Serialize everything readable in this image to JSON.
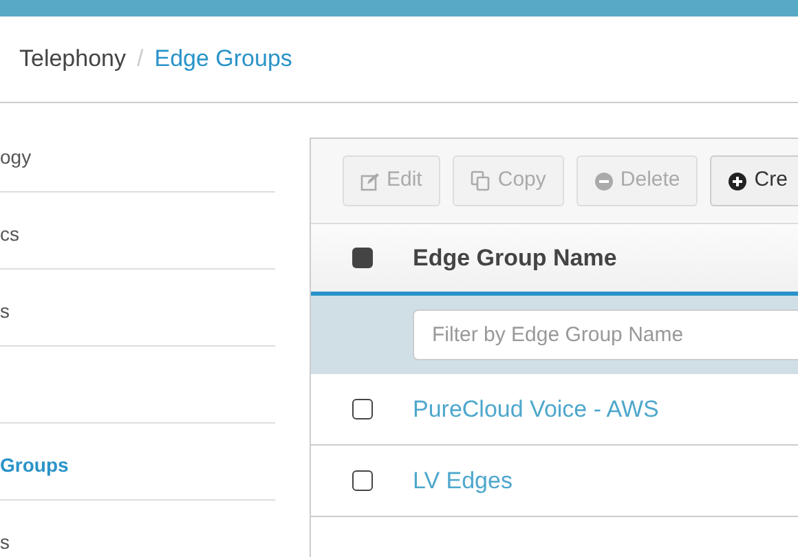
{
  "breadcrumb": {
    "separator": "/",
    "items": [
      {
        "label": "Telephony",
        "selected": false
      },
      {
        "label": "Edge Groups",
        "selected": true
      }
    ]
  },
  "sidebar": {
    "items": [
      {
        "kind": "link",
        "label": "ogy",
        "selected": false
      },
      {
        "kind": "link",
        "label": "cs",
        "selected": false
      },
      {
        "kind": "link",
        "label": "s",
        "selected": false
      },
      {
        "kind": "blank"
      },
      {
        "kind": "link",
        "label": "Groups",
        "selected": true
      },
      {
        "kind": "link",
        "label": "s",
        "selected": false
      }
    ]
  },
  "toolbar": {
    "buttons": [
      {
        "kind": "edit",
        "label": "Edit",
        "disabled": true
      },
      {
        "kind": "copy",
        "label": "Copy",
        "disabled": true
      },
      {
        "kind": "delete",
        "label": "Delete",
        "disabled": true
      },
      {
        "kind": "create",
        "label": "Cre",
        "disabled": false
      }
    ]
  },
  "table": {
    "select_all": {
      "checked": true
    },
    "columns": [
      "Edge Group Name"
    ],
    "filter": {
      "placeholder": "Filter by Edge Group Name"
    },
    "rows": [
      {
        "name": "PureCloud Voice - AWS",
        "checked": false
      },
      {
        "name": "LV Edges",
        "checked": false
      }
    ]
  }
}
